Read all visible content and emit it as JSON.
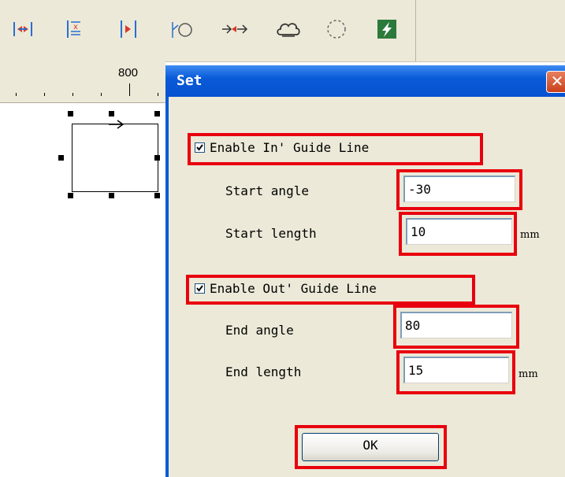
{
  "toolbar": {
    "icons": [
      "align-icon",
      "distribute-icon",
      "center-icon",
      "lead-line-icon",
      "sequence-icon",
      "cloud-icon",
      "circle-dashed-icon",
      "lightning-icon"
    ]
  },
  "ruler": {
    "label": "800"
  },
  "dialog": {
    "title": "Set",
    "close_symbol": "✕",
    "in_guide": {
      "label": "Enable In' Guide Line",
      "checked": true
    },
    "start_angle": {
      "label": "Start angle",
      "value": "-30"
    },
    "start_length": {
      "label": "Start length",
      "value": "10",
      "unit": "mm"
    },
    "out_guide": {
      "label": "Enable Out' Guide Line",
      "checked": true
    },
    "end_angle": {
      "label": "End angle",
      "value": "80"
    },
    "end_length": {
      "label": "End length",
      "value": "15",
      "unit": "mm"
    },
    "ok_label": "OK"
  },
  "colors": {
    "highlight": "#e8000e",
    "titlebar": "#0a5bd8",
    "dialog_bg": "#ece9d8"
  }
}
